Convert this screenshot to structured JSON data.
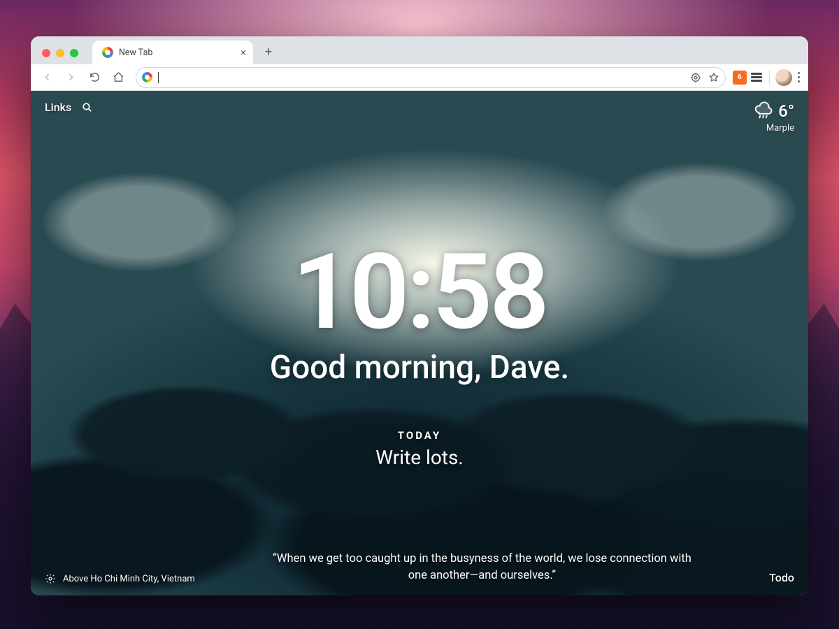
{
  "browser": {
    "tab_title": "New Tab",
    "omnibox_value": ""
  },
  "momentum": {
    "links_label": "Links",
    "weather": {
      "temp": "6°",
      "location": "Marple"
    },
    "clock": "10:58",
    "greeting": "Good morning, Dave.",
    "focus": {
      "label": "TODAY",
      "text": "Write lots."
    },
    "photo_credit": "Above Ho Chi Minh City, Vietnam",
    "quote": "“When we get too caught up in the busyness of the world, we lose connection with one another—and ourselves.”",
    "todo_label": "Todo"
  }
}
